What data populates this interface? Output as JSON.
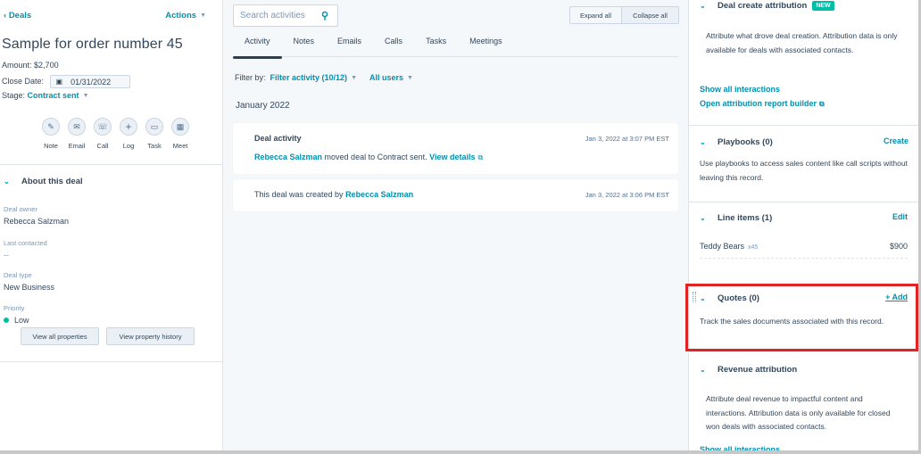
{
  "left": {
    "back_label": "Deals",
    "actions_label": "Actions",
    "deal_title": "Sample for order number 45",
    "amount_label": "Amount:",
    "amount_value": "$2,700",
    "close_date_label": "Close Date:",
    "close_date_value": "01/31/2022",
    "stage_label": "Stage:",
    "stage_value": "Contract sent",
    "quick_actions": [
      {
        "label": "Note",
        "icon": "note-icon"
      },
      {
        "label": "Email",
        "icon": "email-icon"
      },
      {
        "label": "Call",
        "icon": "call-icon"
      },
      {
        "label": "Log",
        "icon": "plus-icon"
      },
      {
        "label": "Task",
        "icon": "task-icon"
      },
      {
        "label": "Meet",
        "icon": "meeting-icon"
      }
    ],
    "about": {
      "title": "About this deal",
      "properties": [
        {
          "label": "Deal owner",
          "value": "Rebecca Salzman"
        },
        {
          "label": "Last contacted",
          "value": "--"
        },
        {
          "label": "Deal type",
          "value": "New Business"
        },
        {
          "label": "Priority",
          "value": "Low"
        }
      ],
      "priority_color": "#00bda5",
      "view_all_label": "View all properties",
      "view_history_label": "View property history"
    }
  },
  "middle": {
    "search_placeholder": "Search activities",
    "expand_all": "Expand all",
    "collapse_all": "Collapse all",
    "tabs": [
      "Activity",
      "Notes",
      "Emails",
      "Calls",
      "Tasks",
      "Meetings"
    ],
    "active_tab": "Activity",
    "filter_by_label": "Filter by:",
    "filter_activity": "Filter activity (10/12)",
    "filter_users": "All users",
    "month": "January 2022",
    "activities": [
      {
        "title": "Deal activity",
        "actor": "Rebecca Salzman",
        "text": " moved deal to Contract sent. ",
        "link": "View details",
        "time": "Jan 3, 2022 at 3:07 PM EST"
      },
      {
        "text": "This deal was created by ",
        "actor": "Rebecca Salzman",
        "time": "Jan 3, 2022 at 3:06 PM EST"
      }
    ]
  },
  "right": {
    "deal_create_attribution": {
      "title": "Deal create attribution",
      "badge": "NEW",
      "description": "Attribute what drove deal creation. Attribution data is only available for deals with associated contacts.",
      "show_all": "Show all interactions",
      "report_builder": "Open attribution report builder"
    },
    "playbooks": {
      "title": "Playbooks (0)",
      "action": "Create",
      "description": "Use playbooks to access sales content like call scripts without leaving this record."
    },
    "line_items": {
      "title": "Line items (1)",
      "action": "Edit",
      "items": [
        {
          "name": "Teddy Bears",
          "qty": "x45",
          "price": "$900"
        }
      ]
    },
    "quotes": {
      "title": "Quotes (0)",
      "action": "+ Add",
      "description": "Track the sales documents associated with this record."
    },
    "revenue_attribution": {
      "title": "Revenue attribution",
      "description": "Attribute deal revenue to impactful content and interactions. Attribution data is only available for closed won deals with associated contacts.",
      "show_all": "Show all interactions"
    }
  },
  "colors": {
    "accent": "#0091ae",
    "text": "#33475b",
    "highlight": "#e02424",
    "badge": "#00bda5"
  }
}
